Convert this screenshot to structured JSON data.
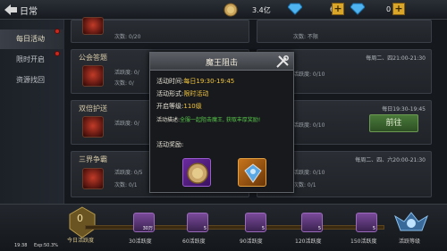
{
  "header": {
    "title": "日常",
    "coins": "3.4亿",
    "diamond1": "6",
    "diamond2": "0"
  },
  "sidebar": {
    "items": [
      {
        "label": "每日活动"
      },
      {
        "label": "限时开启"
      },
      {
        "label": "资源找回"
      }
    ]
  },
  "list": {
    "row0": {
      "count": "次数: 0/20",
      "count_r": "次数: 不限"
    },
    "row1": {
      "name": "公会答题",
      "sub1": "活跃度: 0/",
      "sub2": "次数: 0/",
      "time": "每周二、四21:00-21:30",
      "sub_r": "活跃度: 0/10"
    },
    "row2": {
      "name": "双倍护送",
      "sub1": "活跃度: 0/",
      "time": "每日19:30-19:45",
      "sub_r": "活跃度: 0/10"
    },
    "row3": {
      "name": "三界争霸",
      "sub1": "活跃度: 0/5",
      "sub2": "次数: 0/1",
      "time": "每周二、四、六20:00-21:30",
      "sub_r": "活跃度: 0/10",
      "sub_r2": "次数: 0/1"
    }
  },
  "go_button": "前往",
  "popup": {
    "title": "魔王阻击",
    "time_label": "活动时间:",
    "time_value": "每日19:30-19:45",
    "form_label": "活动形式:",
    "form_value": "限时活动",
    "level_label": "开启等级:",
    "level_value": "110级",
    "desc_label": "活动描述:",
    "desc_value": "全服一起阻击魔王, 获取丰厚奖励!",
    "reward_label": "活动奖励:"
  },
  "bottom": {
    "medal_value": "0",
    "medal_label": "今日活跃度",
    "chests": [
      {
        "label": "30活跃度",
        "count": "30万"
      },
      {
        "label": "60活跃度",
        "count": "5"
      },
      {
        "label": "90活跃度",
        "count": "5"
      },
      {
        "label": "120活跃度",
        "count": "5"
      },
      {
        "label": "150活跃度",
        "count": "5"
      }
    ],
    "level_label": "活跃等级",
    "progress": 0
  },
  "status": {
    "time": "19:38",
    "exp": "Exp:50.3%"
  }
}
